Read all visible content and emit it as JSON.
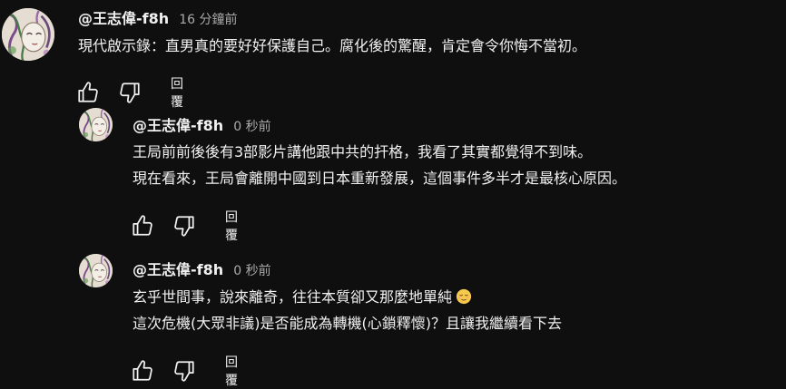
{
  "comments": [
    {
      "author": "@王志偉-f8h",
      "time": "16 分鐘前",
      "lines": [
        "現代啟示錄：直男真的要好好保護自己。腐化後的驚醒，肯定會令你悔不當初。"
      ],
      "reply_label": "回覆"
    },
    {
      "author": "@王志偉-f8h",
      "time": "0 秒前",
      "lines": [
        "王局前前後後有3部影片講他跟中共的扞格，我看了其實都覺得不到味。",
        "現在看來，王局會離開中國到日本重新發展，這個事件多半才是最核心原因。"
      ],
      "reply_label": "回覆"
    },
    {
      "author": "@王志偉-f8h",
      "time": "0 秒前",
      "lines": [
        "玄乎世間事，說來離奇，往往本質卻又那麼地單純",
        "這次危機(大眾非議)是否能成為轉機(心鎖釋懷)？且讓我繼續看下去"
      ],
      "emoji": "relieved-face-emoji",
      "reply_label": "回覆"
    }
  ],
  "icons": [
    "thumbs-up-icon",
    "thumbs-down-icon"
  ],
  "colors": {
    "background": "#0f0f0f",
    "text": "#f1f1f1",
    "secondary": "#aaaaaa"
  }
}
